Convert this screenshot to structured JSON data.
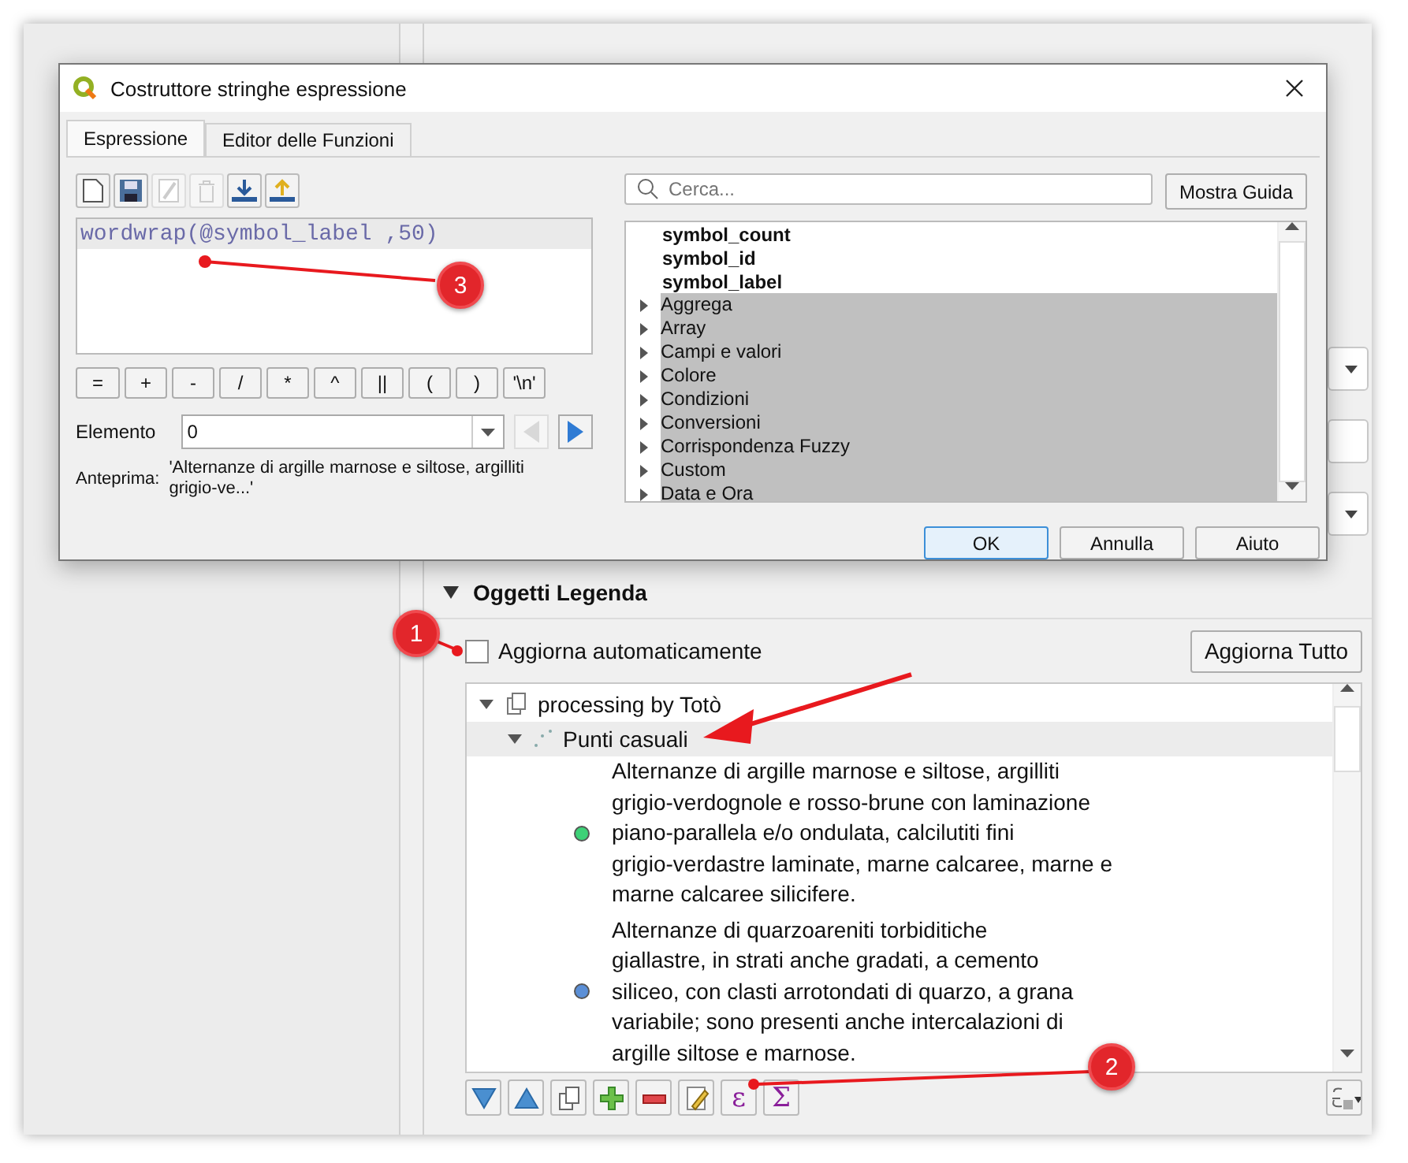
{
  "dialog": {
    "title": "Costruttore stringhe espressione",
    "tabs": [
      {
        "label": "Espressione",
        "selected": true
      },
      {
        "label": "Editor delle Funzioni",
        "selected": false
      }
    ],
    "expression": "wordwrap(@symbol_label ,50)",
    "operators": [
      "=",
      "+",
      "-",
      "/",
      "*",
      "^",
      "||",
      "(",
      ")",
      "'\\n'"
    ],
    "element": {
      "label": "Elemento",
      "value": "0"
    },
    "preview": {
      "label": "Anteprima:",
      "value": "'Alternanze di argille marnose e siltose, argilliti grigio-ve...'"
    },
    "search": {
      "placeholder": "Cerca..."
    },
    "help_button": "Mostra Guida",
    "functions": [
      {
        "label": "symbol_count",
        "kind": "variable"
      },
      {
        "label": "symbol_id",
        "kind": "variable"
      },
      {
        "label": "symbol_label",
        "kind": "variable"
      },
      {
        "label": "Aggrega",
        "kind": "group"
      },
      {
        "label": "Array",
        "kind": "group"
      },
      {
        "label": "Campi e valori",
        "kind": "group"
      },
      {
        "label": "Colore",
        "kind": "group"
      },
      {
        "label": "Condizioni",
        "kind": "group"
      },
      {
        "label": "Conversioni",
        "kind": "group"
      },
      {
        "label": "Corrispondenza Fuzzy",
        "kind": "group"
      },
      {
        "label": "Custom",
        "kind": "group"
      },
      {
        "label": "Data e Ora",
        "kind": "group"
      }
    ],
    "buttons": [
      {
        "label": "OK",
        "selected": true
      },
      {
        "label": "Annulla",
        "selected": false
      },
      {
        "label": "Aiuto",
        "selected": false
      }
    ]
  },
  "legend": {
    "title": "Oggetti Legenda",
    "expanded": true,
    "auto_update": {
      "label": "Aggiorna automaticamente",
      "checked": false
    },
    "update_all": "Aggiorna Tutto",
    "tree": [
      {
        "label": "processing by Totò",
        "expanded": true,
        "children": [
          {
            "label": "Punti casuali",
            "expanded": true,
            "children": [
              {
                "color": "#3dd177",
                "lines": [
                  "Alternanze di argille marnose e siltose, argilliti",
                  "grigio-verdognole e rosso-brune con laminazione",
                  "piano-parallela e/o ondulata, calcilutiti fini",
                  "grigio-verdastre laminate, marne calcaree, marne e",
                  "marne calcaree silicifere."
                ]
              },
              {
                "color": "#5b8fd6",
                "lines": [
                  "Alternanze di quarzoareniti torbiditiche",
                  "giallastre, in strati anche gradati, a cemento",
                  "siliceo, con clasti arrotondati di quarzo, a grana",
                  "variabile; sono presenti anche intercalazioni di",
                  "argille siltose e marnose."
                ]
              }
            ]
          }
        ]
      }
    ],
    "toolbar_glyphs": [
      "ε",
      "Σ"
    ]
  },
  "callouts": [
    "1",
    "2",
    "3"
  ]
}
